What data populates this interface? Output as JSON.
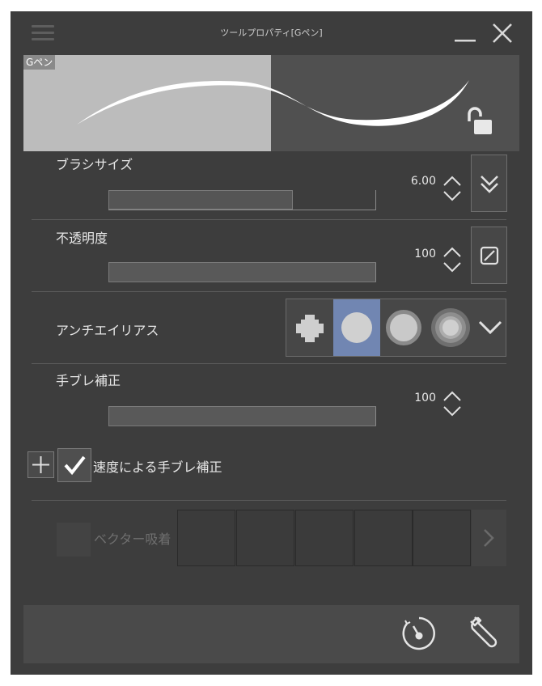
{
  "window": {
    "title": "ツールプロパティ[Gペン]"
  },
  "preview": {
    "brush_name": "Gペン"
  },
  "brush_size": {
    "label": "ブラシサイズ",
    "value": "6.00",
    "slider_fraction": 0.69
  },
  "opacity": {
    "label": "不透明度",
    "value": "100",
    "slider_fraction": 1.0
  },
  "antialias": {
    "label": "アンチエイリアス",
    "options": [
      "none",
      "weak",
      "medium",
      "strong"
    ],
    "selected": "weak"
  },
  "stabilization": {
    "label": "手ブレ補正",
    "value": "100",
    "slider_fraction": 1.0
  },
  "speed_stabilization": {
    "label": "速度による手ブレ補正",
    "checked": true
  },
  "vector_snap": {
    "label": "ベクター吸着",
    "enabled": false
  },
  "colors": {
    "panel_bg": "#3d3d3d",
    "selected_accent": "#7186b2"
  },
  "icons": {
    "menu": "hamburger-icon",
    "minimize": "minimize-icon",
    "close": "close-icon",
    "lock": "unlock-icon",
    "pressure": "double-chevron-down-icon",
    "reset": "slash-square-icon",
    "expand": "plus-icon",
    "chevron": "chevron-right-icon",
    "initial_settings": "clock-reset-icon",
    "settings": "wrench-icon"
  }
}
